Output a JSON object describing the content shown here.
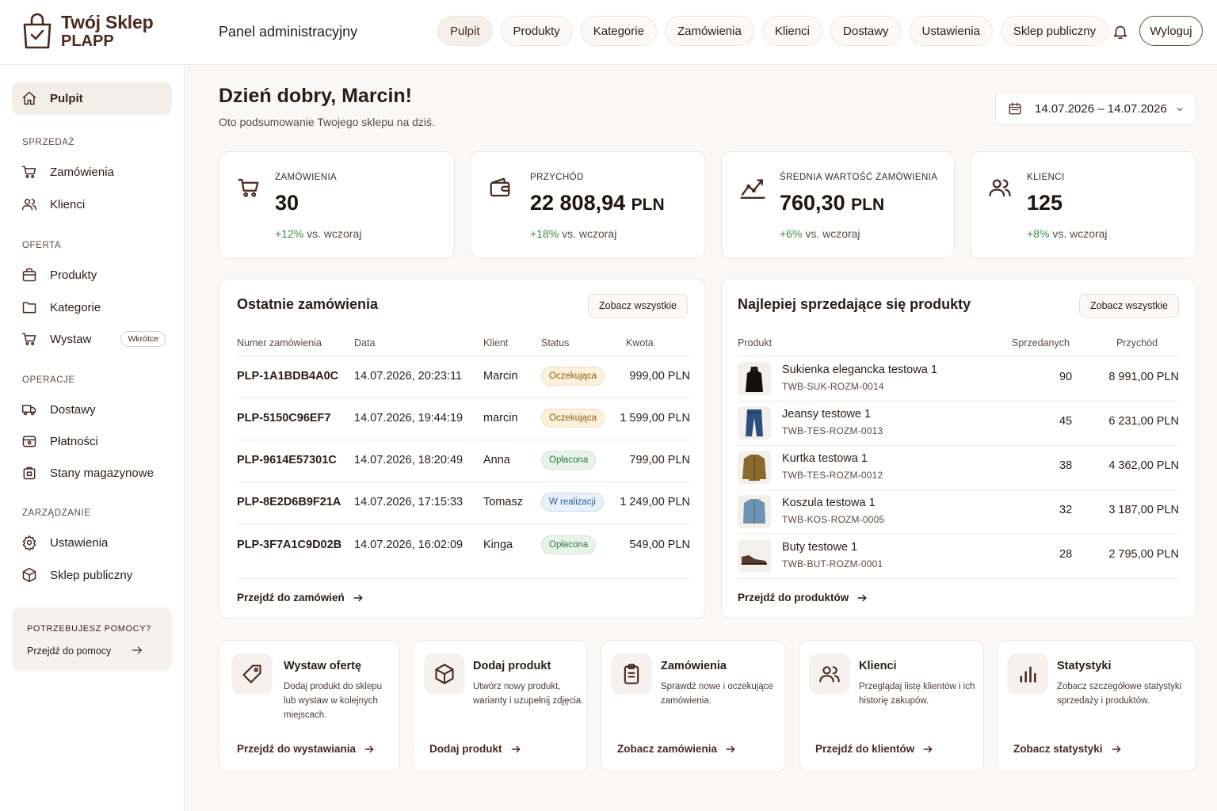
{
  "brand": {
    "line1": "Twój Sklep",
    "line2": "PLAPP"
  },
  "header": {
    "title": "Panel administracyjny",
    "nav": [
      "Pulpit",
      "Produkty",
      "Kategorie",
      "Zamówienia",
      "Klienci",
      "Dostawy",
      "Ustawienia",
      "Sklep publiczny"
    ],
    "logout": "Wyloguj"
  },
  "sidebar": {
    "active": "Pulpit",
    "sections": [
      "SPRZEDAŻ",
      "OFERTA",
      "OPERACJE",
      "ZARZĄDZANIE"
    ],
    "items": [
      "Zamówienia",
      "Klienci",
      "Produkty",
      "Kategorie",
      "Wystaw",
      "Dostawy",
      "Płatności",
      "Stany magazynowe",
      "Ustawienia",
      "Sklep publiczny"
    ],
    "soon_badge": "Wkrótce",
    "help_title": "POTRZEBUJESZ POMOCY?",
    "help_link": "Przejdź do pomocy"
  },
  "greeting": {
    "title": "Dzień dobry, Marcin!",
    "subtitle": "Oto podsumowanie Twojego sklepu na dziś."
  },
  "date_range": "14.07.2026 – 14.07.2026",
  "stats": [
    {
      "label": "ZAMÓWIENIA",
      "value": "30",
      "unit": "",
      "change": "+12%",
      "suffix": "vs. wczoraj"
    },
    {
      "label": "PRZYCHÓD",
      "value": "22 808,94",
      "unit": "PLN",
      "change": "+18%",
      "suffix": "vs. wczoraj"
    },
    {
      "label": "ŚREDNIA WARTOŚĆ ZAMÓWIENIA",
      "value": "760,30",
      "unit": "PLN",
      "change": "+6%",
      "suffix": "vs. wczoraj"
    },
    {
      "label": "KLIENCI",
      "value": "125",
      "unit": "",
      "change": "+8%",
      "suffix": "vs. wczoraj"
    }
  ],
  "orders": {
    "title": "Ostatnie zamówienia",
    "see_all": "Zobacz wszystkie",
    "columns": [
      "Numer zamówienia",
      "Data",
      "Klient",
      "Status",
      "Kwota"
    ],
    "rows": [
      {
        "id": "PLP-1A1BDB4A0C",
        "date": "14.07.2026, 20:23:11",
        "client": "Marcin",
        "status": "Oczekująca",
        "amount": "999,00 PLN"
      },
      {
        "id": "PLP-5150C96EF7",
        "date": "14.07.2026, 19:44:19",
        "client": "marcin",
        "status": "Oczekująca",
        "amount": "1 599,00 PLN"
      },
      {
        "id": "PLP-9614E57301C",
        "date": "14.07.2026, 18:20:49",
        "client": "Anna",
        "status": "Opłacona",
        "amount": "799,00 PLN"
      },
      {
        "id": "PLP-8E2D6B9F21A",
        "date": "14.07.2026, 17:15:33",
        "client": "Tomasz",
        "status": "W realizacji",
        "amount": "1 249,00 PLN"
      },
      {
        "id": "PLP-3F7A1C9D02B",
        "date": "14.07.2026, 16:02:09",
        "client": "Kinga",
        "status": "Opłacona",
        "amount": "549,00 PLN"
      }
    ],
    "footer": "Przejdź do zamówień"
  },
  "products": {
    "title": "Najlepiej sprzedające się produkty",
    "see_all": "Zobacz wszystkie",
    "columns": [
      "Produkt",
      "Sprzedanych",
      "Przychód"
    ],
    "rows": [
      {
        "name": "Sukienka elegancka testowa 1",
        "sku": "TWB-SUK-ROZM-0014",
        "sold": "90",
        "revenue": "8 991,00 PLN",
        "thumb": "dress-icon"
      },
      {
        "name": "Jeansy testowe 1",
        "sku": "TWB-TES-ROZM-0013",
        "sold": "45",
        "revenue": "6 231,00 PLN",
        "thumb": "jeans-icon"
      },
      {
        "name": "Kurtka testowa 1",
        "sku": "TWB-TES-ROZM-0012",
        "sold": "38",
        "revenue": "4 362,00 PLN",
        "thumb": "jacket-icon"
      },
      {
        "name": "Koszula testowa 1",
        "sku": "TWB-KOS-ROZM-0005",
        "sold": "32",
        "revenue": "3 187,00 PLN",
        "thumb": "shirt-icon"
      },
      {
        "name": "Buty testowe 1",
        "sku": "TWB-BUT-ROZM-0001",
        "sold": "28",
        "revenue": "2 795,00 PLN",
        "thumb": "shoe-icon"
      }
    ],
    "footer": "Przejdź do produktów"
  },
  "quick_actions": [
    {
      "title": "Wystaw ofertę",
      "desc": "Dodaj produkt do sklepu lub wystaw w kolejnych miejscach.",
      "link": "Przejdź do wystawiania",
      "icon": "tag-icon"
    },
    {
      "title": "Dodaj produkt",
      "desc": "Utwórz nowy produkt, warianty i uzupełnij zdjęcia.",
      "link": "Dodaj produkt",
      "icon": "box-icon"
    },
    {
      "title": "Zamówienia",
      "desc": "Sprawdź nowe i oczekujące zamówienia.",
      "link": "Zobacz zamówienia",
      "icon": "clipboard-icon"
    },
    {
      "title": "Klienci",
      "desc": "Przeglądaj listę klientów i ich historię zakupów.",
      "link": "Przejdź do klientów",
      "icon": "users-icon"
    },
    {
      "title": "Statystyki",
      "desc": "Zobacz szczegółowe statystyki sprzedaży i produktów.",
      "link": "Zobacz statystyki",
      "icon": "bar-chart-icon"
    }
  ],
  "colors": {
    "accent": "#4a2a1e",
    "positive": "#3d8a4a",
    "pending": "#fdf1dc",
    "paid": "#e8f4ea",
    "in_progress": "#e9f1fb"
  }
}
